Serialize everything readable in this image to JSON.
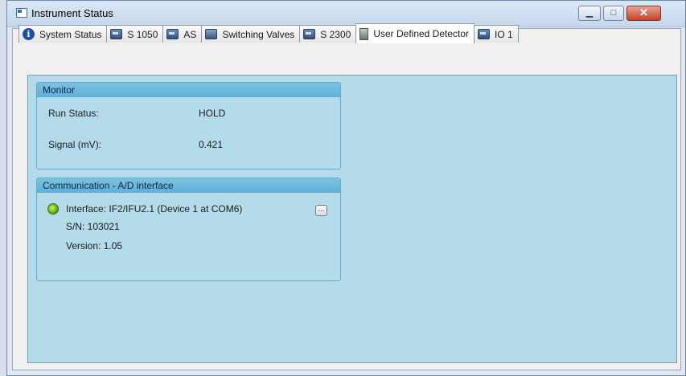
{
  "window": {
    "title": "Instrument Status",
    "minimize_glyph": "▁",
    "maximize_glyph": "□",
    "close_glyph": "✕"
  },
  "tabs": [
    {
      "label": "System Status",
      "icon": "info-icon"
    },
    {
      "label": "S 1050",
      "icon": "device-icon"
    },
    {
      "label": "AS",
      "icon": "device-icon"
    },
    {
      "label": "Switching Valves",
      "icon": "valve-icon"
    },
    {
      "label": "S 2300",
      "icon": "device-icon"
    },
    {
      "label": "User Defined Detector",
      "icon": "detector-icon",
      "active": true
    },
    {
      "label": "IO 1",
      "icon": "device-icon"
    }
  ],
  "monitor": {
    "header": "Monitor",
    "run_status_label": "Run Status:",
    "run_status_value": "HOLD",
    "signal_label": "Signal (mV):",
    "signal_value": "0.421"
  },
  "communication": {
    "header": "Communication - A/D interface",
    "interface": "Interface: IF2/IFU2.1 (Device 1 at COM6)",
    "serial": "S/N: 103021",
    "version": "Version: 1.05",
    "more_button": "...",
    "status_color": "#5fae12"
  },
  "colors": {
    "panel_bg": "#b3dbea",
    "group_header": "#6ab8de",
    "close_button": "#c2422a"
  }
}
